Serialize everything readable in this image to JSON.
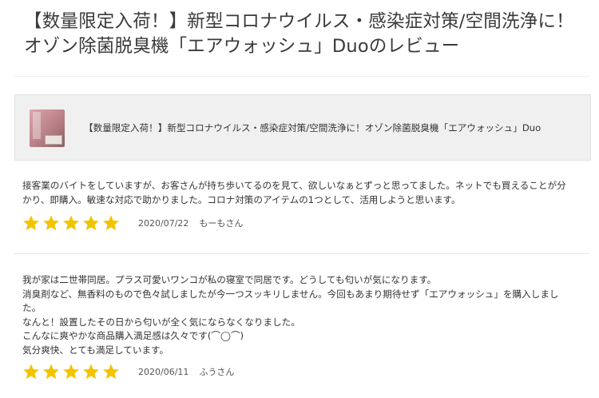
{
  "page": {
    "title": "【数量限定入荷！】新型コロナウイルス・感染症対策/空間洗浄に！オゾン除菌脱臭機「エアウォッシュ」Duoのレビュー"
  },
  "product": {
    "name": "【数量限定入荷！】新型コロナウイルス・感染症対策/空間洗浄に！オゾン除菌脱臭機「エアウォッシュ」Duo",
    "thumbnail_icon": "product-image"
  },
  "colors": {
    "star": "#f2c400",
    "card_bg": "#f0f0f0",
    "rule": "#e6e6e6"
  },
  "reviews": [
    {
      "lines": [
        "接客業のバイトをしていますが、お客さんが持ち歩いてるのを見て、欲しいなぁとずっと思ってました。ネットでも買えることが分",
        "かり、即購入。敏速な対応で助かりました。コロナ対策のアイテムの1つとして、活用しようと思います。"
      ],
      "rating": 5,
      "date": "2020/07/22",
      "author": "もーもさん"
    },
    {
      "lines": [
        "我が家は二世帯同居。プラス可愛いワンコが私の寝室で同居です。どうしても匂いが気になります。",
        "消臭剤など、無香料のもので色々試しましたが今一つスッキリしません。今回もあまり期待せず「エアウォッシュ」を購入しまし",
        "た。",
        "なんと！設置したその日から匂いが全く気にならなくなりました。",
        "こんなに爽やかな商品購入満足感は久々です(⌒◯⌒)",
        "気分爽快、とても満足しています。"
      ],
      "rating": 5,
      "date": "2020/06/11",
      "author": "ふうさん"
    }
  ]
}
